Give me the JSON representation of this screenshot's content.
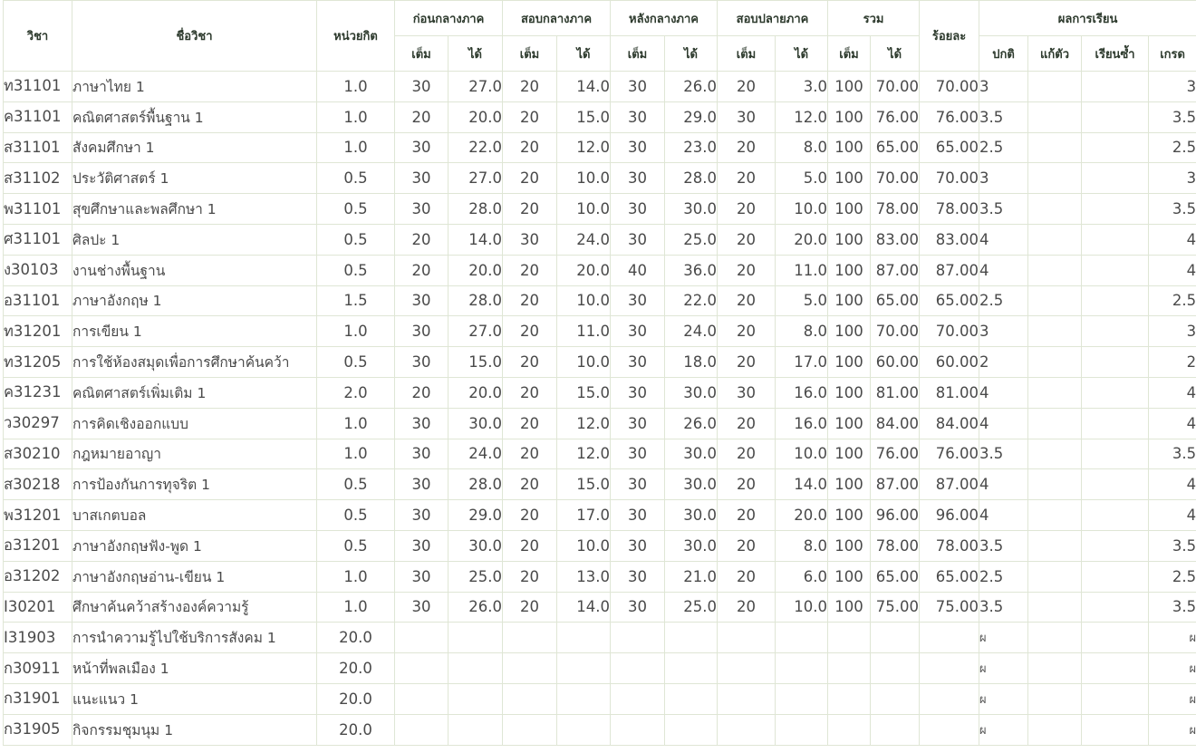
{
  "headers": {
    "code": "วิชา",
    "name": "ชื่อวิชา",
    "credit": "หน่วยกิต",
    "pre_mid": "ก่อนกลางภาค",
    "mid_exam": "สอบกลางภาค",
    "post_mid": "หลังกลางภาค",
    "final_exam": "สอบปลายภาค",
    "total": "รวม",
    "percent": "ร้อยละ",
    "result": "ผลการเรียน",
    "full": "เต็ม",
    "got": "ได้",
    "normal": "ปกติ",
    "remedial": "แก้ตัว",
    "repeat": "เรียนซ้ำ",
    "grade": "เกรด"
  },
  "rows": [
    {
      "code": "ท31101",
      "name": "ภาษาไทย 1",
      "credit": "1.0",
      "pf": "30",
      "pg": "27.0",
      "mf": "20",
      "mg": "14.0",
      "af": "30",
      "ag": "26.0",
      "ff": "20",
      "fg": "3.0",
      "tf": "100",
      "tg": "70.00",
      "pct": "70.00",
      "normal": "3",
      "remedial": "",
      "repeat": "",
      "grade": "3"
    },
    {
      "code": "ค31101",
      "name": "คณิตศาสตร์พื้นฐาน 1",
      "credit": "1.0",
      "pf": "20",
      "pg": "20.0",
      "mf": "20",
      "mg": "15.0",
      "af": "30",
      "ag": "29.0",
      "ff": "30",
      "fg": "12.0",
      "tf": "100",
      "tg": "76.00",
      "pct": "76.00",
      "normal": "3.5",
      "remedial": "",
      "repeat": "",
      "grade": "3.5"
    },
    {
      "code": "ส31101",
      "name": "สังคมศึกษา 1",
      "credit": "1.0",
      "pf": "30",
      "pg": "22.0",
      "mf": "20",
      "mg": "12.0",
      "af": "30",
      "ag": "23.0",
      "ff": "20",
      "fg": "8.0",
      "tf": "100",
      "tg": "65.00",
      "pct": "65.00",
      "normal": "2.5",
      "remedial": "",
      "repeat": "",
      "grade": "2.5"
    },
    {
      "code": "ส31102",
      "name": "ประวัติศาสตร์ 1",
      "credit": "0.5",
      "pf": "30",
      "pg": "27.0",
      "mf": "20",
      "mg": "10.0",
      "af": "30",
      "ag": "28.0",
      "ff": "20",
      "fg": "5.0",
      "tf": "100",
      "tg": "70.00",
      "pct": "70.00",
      "normal": "3",
      "remedial": "",
      "repeat": "",
      "grade": "3"
    },
    {
      "code": "พ31101",
      "name": "สุขศึกษาและพลศึกษา 1",
      "credit": "0.5",
      "pf": "30",
      "pg": "28.0",
      "mf": "20",
      "mg": "10.0",
      "af": "30",
      "ag": "30.0",
      "ff": "20",
      "fg": "10.0",
      "tf": "100",
      "tg": "78.00",
      "pct": "78.00",
      "normal": "3.5",
      "remedial": "",
      "repeat": "",
      "grade": "3.5"
    },
    {
      "code": "ศ31101",
      "name": "ศิลปะ 1",
      "credit": "0.5",
      "pf": "20",
      "pg": "14.0",
      "mf": "30",
      "mg": "24.0",
      "af": "30",
      "ag": "25.0",
      "ff": "20",
      "fg": "20.0",
      "tf": "100",
      "tg": "83.00",
      "pct": "83.00",
      "normal": "4",
      "remedial": "",
      "repeat": "",
      "grade": "4"
    },
    {
      "code": "ง30103",
      "name": "งานช่างพื้นฐาน",
      "credit": "0.5",
      "pf": "20",
      "pg": "20.0",
      "mf": "20",
      "mg": "20.0",
      "af": "40",
      "ag": "36.0",
      "ff": "20",
      "fg": "11.0",
      "tf": "100",
      "tg": "87.00",
      "pct": "87.00",
      "normal": "4",
      "remedial": "",
      "repeat": "",
      "grade": "4"
    },
    {
      "code": "อ31101",
      "name": "ภาษาอังกฤษ 1",
      "credit": "1.5",
      "pf": "30",
      "pg": "28.0",
      "mf": "20",
      "mg": "10.0",
      "af": "30",
      "ag": "22.0",
      "ff": "20",
      "fg": "5.0",
      "tf": "100",
      "tg": "65.00",
      "pct": "65.00",
      "normal": "2.5",
      "remedial": "",
      "repeat": "",
      "grade": "2.5"
    },
    {
      "code": "ท31201",
      "name": "การเขียน 1",
      "credit": "1.0",
      "pf": "30",
      "pg": "27.0",
      "mf": "20",
      "mg": "11.0",
      "af": "30",
      "ag": "24.0",
      "ff": "20",
      "fg": "8.0",
      "tf": "100",
      "tg": "70.00",
      "pct": "70.00",
      "normal": "3",
      "remedial": "",
      "repeat": "",
      "grade": "3"
    },
    {
      "code": "ท31205",
      "name": "การใช้ห้องสมุดเพื่อการศึกษาค้นคว้า",
      "credit": "0.5",
      "pf": "30",
      "pg": "15.0",
      "mf": "20",
      "mg": "10.0",
      "af": "30",
      "ag": "18.0",
      "ff": "20",
      "fg": "17.0",
      "tf": "100",
      "tg": "60.00",
      "pct": "60.00",
      "normal": "2",
      "remedial": "",
      "repeat": "",
      "grade": "2"
    },
    {
      "code": "ค31231",
      "name": "คณิตศาสตร์เพิ่มเติม 1",
      "credit": "2.0",
      "pf": "20",
      "pg": "20.0",
      "mf": "20",
      "mg": "15.0",
      "af": "30",
      "ag": "30.0",
      "ff": "30",
      "fg": "16.0",
      "tf": "100",
      "tg": "81.00",
      "pct": "81.00",
      "normal": "4",
      "remedial": "",
      "repeat": "",
      "grade": "4"
    },
    {
      "code": "ว30297",
      "name": "การคิดเชิงออกแบบ",
      "credit": "1.0",
      "pf": "30",
      "pg": "30.0",
      "mf": "20",
      "mg": "12.0",
      "af": "30",
      "ag": "26.0",
      "ff": "20",
      "fg": "16.0",
      "tf": "100",
      "tg": "84.00",
      "pct": "84.00",
      "normal": "4",
      "remedial": "",
      "repeat": "",
      "grade": "4"
    },
    {
      "code": "ส30210",
      "name": "กฎหมายอาญา",
      "credit": "1.0",
      "pf": "30",
      "pg": "24.0",
      "mf": "20",
      "mg": "12.0",
      "af": "30",
      "ag": "30.0",
      "ff": "20",
      "fg": "10.0",
      "tf": "100",
      "tg": "76.00",
      "pct": "76.00",
      "normal": "3.5",
      "remedial": "",
      "repeat": "",
      "grade": "3.5"
    },
    {
      "code": "ส30218",
      "name": "การป้องกันการทุจริต 1",
      "credit": "0.5",
      "pf": "30",
      "pg": "28.0",
      "mf": "20",
      "mg": "15.0",
      "af": "30",
      "ag": "30.0",
      "ff": "20",
      "fg": "14.0",
      "tf": "100",
      "tg": "87.00",
      "pct": "87.00",
      "normal": "4",
      "remedial": "",
      "repeat": "",
      "grade": "4"
    },
    {
      "code": "พ31201",
      "name": "บาสเกตบอล",
      "credit": "0.5",
      "pf": "30",
      "pg": "29.0",
      "mf": "20",
      "mg": "17.0",
      "af": "30",
      "ag": "30.0",
      "ff": "20",
      "fg": "20.0",
      "tf": "100",
      "tg": "96.00",
      "pct": "96.00",
      "normal": "4",
      "remedial": "",
      "repeat": "",
      "grade": "4"
    },
    {
      "code": "อ31201",
      "name": "ภาษาอังกฤษฟัง-พูด 1",
      "credit": "0.5",
      "pf": "30",
      "pg": "30.0",
      "mf": "20",
      "mg": "10.0",
      "af": "30",
      "ag": "30.0",
      "ff": "20",
      "fg": "8.0",
      "tf": "100",
      "tg": "78.00",
      "pct": "78.00",
      "normal": "3.5",
      "remedial": "",
      "repeat": "",
      "grade": "3.5"
    },
    {
      "code": "อ31202",
      "name": "ภาษาอังกฤษอ่าน-เขียน 1",
      "credit": "1.0",
      "pf": "30",
      "pg": "25.0",
      "mf": "20",
      "mg": "13.0",
      "af": "30",
      "ag": "21.0",
      "ff": "20",
      "fg": "6.0",
      "tf": "100",
      "tg": "65.00",
      "pct": "65.00",
      "normal": "2.5",
      "remedial": "",
      "repeat": "",
      "grade": "2.5"
    },
    {
      "code": "I30201",
      "name": "ศึกษาค้นคว้าสร้างองค์ความรู้",
      "credit": "1.0",
      "pf": "30",
      "pg": "26.0",
      "mf": "20",
      "mg": "14.0",
      "af": "30",
      "ag": "25.0",
      "ff": "20",
      "fg": "10.0",
      "tf": "100",
      "tg": "75.00",
      "pct": "75.00",
      "normal": "3.5",
      "remedial": "",
      "repeat": "",
      "grade": "3.5"
    },
    {
      "code": "I31903",
      "name": "การนำความรู้ไปใช้บริการสังคม 1",
      "credit": "20.0",
      "pf": "",
      "pg": "",
      "mf": "",
      "mg": "",
      "af": "",
      "ag": "",
      "ff": "",
      "fg": "",
      "tf": "",
      "tg": "",
      "pct": "",
      "normal": "ผ",
      "remedial": "",
      "repeat": "",
      "grade": "ผ"
    },
    {
      "code": "ก30911",
      "name": "หน้าที่พลเมือง 1",
      "credit": "20.0",
      "pf": "",
      "pg": "",
      "mf": "",
      "mg": "",
      "af": "",
      "ag": "",
      "ff": "",
      "fg": "",
      "tf": "",
      "tg": "",
      "pct": "",
      "normal": "ผ",
      "remedial": "",
      "repeat": "",
      "grade": "ผ"
    },
    {
      "code": "ก31901",
      "name": "แนะแนว 1",
      "credit": "20.0",
      "pf": "",
      "pg": "",
      "mf": "",
      "mg": "",
      "af": "",
      "ag": "",
      "ff": "",
      "fg": "",
      "tf": "",
      "tg": "",
      "pct": "",
      "normal": "ผ",
      "remedial": "",
      "repeat": "",
      "grade": "ผ"
    },
    {
      "code": "ก31905",
      "name": "กิจกรรมชุมนุม 1",
      "credit": "20.0",
      "pf": "",
      "pg": "",
      "mf": "",
      "mg": "",
      "af": "",
      "ag": "",
      "ff": "",
      "fg": "",
      "tf": "",
      "tg": "",
      "pct": "",
      "normal": "ผ",
      "remedial": "",
      "repeat": "",
      "grade": "ผ"
    }
  ]
}
